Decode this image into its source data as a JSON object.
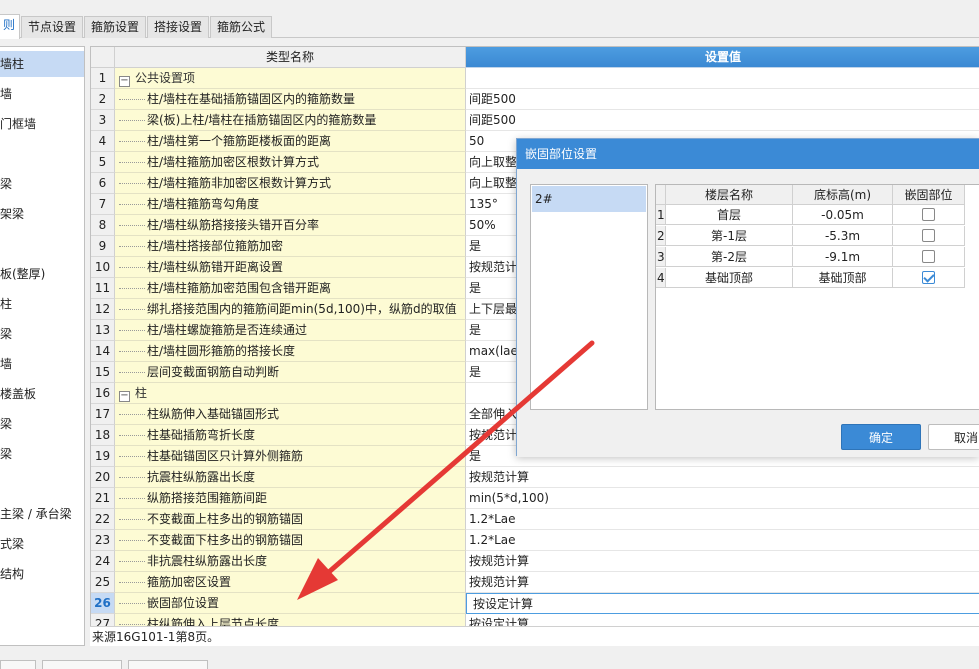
{
  "tabs": [
    {
      "label": "则",
      "active": true
    },
    {
      "label": "节点设置"
    },
    {
      "label": "箍筋设置"
    },
    {
      "label": "搭接设置"
    },
    {
      "label": "箍筋公式"
    }
  ],
  "left_items": [
    {
      "label": "墙柱",
      "selected": true
    },
    {
      "label": "墙"
    },
    {
      "label": "门框墙"
    },
    {
      "label": ""
    },
    {
      "label": "梁"
    },
    {
      "label": "架梁"
    },
    {
      "label": ""
    },
    {
      "label": "板(整厚)"
    },
    {
      "label": "柱"
    },
    {
      "label": "梁"
    },
    {
      "label": "墙"
    },
    {
      "label": "楼盖板"
    },
    {
      "label": "梁"
    },
    {
      "label": "梁"
    },
    {
      "label": ""
    },
    {
      "label": "主梁 / 承台梁"
    },
    {
      "label": "式梁"
    },
    {
      "label": "结构"
    }
  ],
  "grid": {
    "col_name": "类型名称",
    "col_value": "设置值",
    "rows": [
      {
        "num": "1",
        "name": "公共设置项",
        "value": "",
        "group": true
      },
      {
        "num": "2",
        "name": "柱/墙柱在基础插筋锚固区内的箍筋数量",
        "value": "间距500"
      },
      {
        "num": "3",
        "name": "梁(板)上柱/墙柱在插筋锚固区内的箍筋数量",
        "value": "间距500"
      },
      {
        "num": "4",
        "name": "柱/墙柱第一个箍筋距楼板面的距离",
        "value": "50"
      },
      {
        "num": "5",
        "name": "柱/墙柱箍筋加密区根数计算方式",
        "value": "向上取整"
      },
      {
        "num": "6",
        "name": "柱/墙柱箍筋非加密区根数计算方式",
        "value": "向上取整"
      },
      {
        "num": "7",
        "name": "柱/墙柱箍筋弯勾角度",
        "value": "135°"
      },
      {
        "num": "8",
        "name": "柱/墙柱纵筋搭接接头错开百分率",
        "value": "50%"
      },
      {
        "num": "9",
        "name": "柱/墙柱搭接部位箍筋加密",
        "value": "是"
      },
      {
        "num": "10",
        "name": "柱/墙柱纵筋错开距离设置",
        "value": "按规范计"
      },
      {
        "num": "11",
        "name": "柱/墙柱箍筋加密范围包含错开距离",
        "value": "是"
      },
      {
        "num": "12",
        "name": "绑扎搭接范围内的箍筋间距min(5d,100)中，纵筋d的取值",
        "value": "上下层最"
      },
      {
        "num": "13",
        "name": "柱/墙柱螺旋箍筋是否连续通过",
        "value": "是"
      },
      {
        "num": "14",
        "name": "柱/墙柱圆形箍筋的搭接长度",
        "value": "max(lae,"
      },
      {
        "num": "15",
        "name": "层间变截面钢筋自动判断",
        "value": "是"
      },
      {
        "num": "16",
        "name": "柱",
        "value": "",
        "group": true
      },
      {
        "num": "17",
        "name": "柱纵筋伸入基础锚固形式",
        "value": "全部伸入"
      },
      {
        "num": "18",
        "name": "柱基础插筋弯折长度",
        "value": "按规范计"
      },
      {
        "num": "19",
        "name": "柱基础锚固区只计算外侧箍筋",
        "value": "是"
      },
      {
        "num": "20",
        "name": "抗震柱纵筋露出长度",
        "value": "按规范计算"
      },
      {
        "num": "21",
        "name": "纵筋搭接范围箍筋间距",
        "value": "min(5*d,100)"
      },
      {
        "num": "22",
        "name": "不变截面上柱多出的钢筋锚固",
        "value": "1.2*Lae"
      },
      {
        "num": "23",
        "name": "不变截面下柱多出的钢筋锚固",
        "value": "1.2*Lae"
      },
      {
        "num": "24",
        "name": "非抗震柱纵筋露出长度",
        "value": "按规范计算"
      },
      {
        "num": "25",
        "name": "箍筋加密区设置",
        "value": "按规范计算"
      },
      {
        "num": "26",
        "name": "嵌固部位设置",
        "value": "按设定计算",
        "selected": true
      },
      {
        "num": "27",
        "name": "柱纵筋伸入上层节点长度",
        "value": "按设定计算"
      }
    ]
  },
  "source_text": "来源16G101-1第8页。",
  "dialog": {
    "title": "嵌固部位设置",
    "list": [
      "2#"
    ],
    "columns": [
      "楼层名称",
      "底标高(m)",
      "嵌固部位"
    ],
    "rows": [
      {
        "num": "1",
        "floor": "首层",
        "elev": "-0.05m",
        "checked": false
      },
      {
        "num": "2",
        "floor": "第-1层",
        "elev": "-5.3m",
        "checked": false
      },
      {
        "num": "3",
        "floor": "第-2层",
        "elev": "-9.1m",
        "checked": false
      },
      {
        "num": "4",
        "floor": "基础顶部",
        "elev": "基础顶部",
        "checked": true
      }
    ],
    "ok_label": "确定",
    "cancel_label": "取消"
  },
  "accent_color": "#3b8ad6",
  "arrow_color": "#e53935"
}
